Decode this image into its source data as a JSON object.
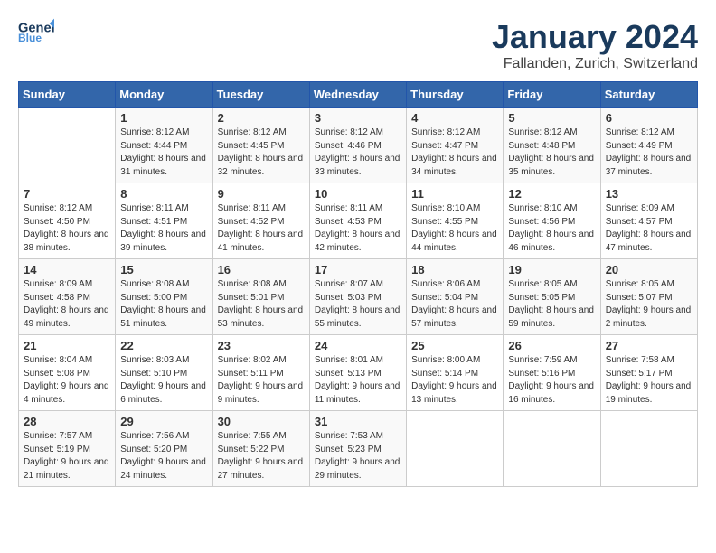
{
  "logo": {
    "general": "General",
    "blue": "Blue"
  },
  "header": {
    "title": "January 2024",
    "subtitle": "Fallanden, Zurich, Switzerland"
  },
  "weekdays": [
    "Sunday",
    "Monday",
    "Tuesday",
    "Wednesday",
    "Thursday",
    "Friday",
    "Saturday"
  ],
  "weeks": [
    [
      {
        "day": "",
        "sunrise": "",
        "sunset": "",
        "daylight": ""
      },
      {
        "day": "1",
        "sunrise": "Sunrise: 8:12 AM",
        "sunset": "Sunset: 4:44 PM",
        "daylight": "Daylight: 8 hours and 31 minutes."
      },
      {
        "day": "2",
        "sunrise": "Sunrise: 8:12 AM",
        "sunset": "Sunset: 4:45 PM",
        "daylight": "Daylight: 8 hours and 32 minutes."
      },
      {
        "day": "3",
        "sunrise": "Sunrise: 8:12 AM",
        "sunset": "Sunset: 4:46 PM",
        "daylight": "Daylight: 8 hours and 33 minutes."
      },
      {
        "day": "4",
        "sunrise": "Sunrise: 8:12 AM",
        "sunset": "Sunset: 4:47 PM",
        "daylight": "Daylight: 8 hours and 34 minutes."
      },
      {
        "day": "5",
        "sunrise": "Sunrise: 8:12 AM",
        "sunset": "Sunset: 4:48 PM",
        "daylight": "Daylight: 8 hours and 35 minutes."
      },
      {
        "day": "6",
        "sunrise": "Sunrise: 8:12 AM",
        "sunset": "Sunset: 4:49 PM",
        "daylight": "Daylight: 8 hours and 37 minutes."
      }
    ],
    [
      {
        "day": "7",
        "sunrise": "Sunrise: 8:12 AM",
        "sunset": "Sunset: 4:50 PM",
        "daylight": "Daylight: 8 hours and 38 minutes."
      },
      {
        "day": "8",
        "sunrise": "Sunrise: 8:11 AM",
        "sunset": "Sunset: 4:51 PM",
        "daylight": "Daylight: 8 hours and 39 minutes."
      },
      {
        "day": "9",
        "sunrise": "Sunrise: 8:11 AM",
        "sunset": "Sunset: 4:52 PM",
        "daylight": "Daylight: 8 hours and 41 minutes."
      },
      {
        "day": "10",
        "sunrise": "Sunrise: 8:11 AM",
        "sunset": "Sunset: 4:53 PM",
        "daylight": "Daylight: 8 hours and 42 minutes."
      },
      {
        "day": "11",
        "sunrise": "Sunrise: 8:10 AM",
        "sunset": "Sunset: 4:55 PM",
        "daylight": "Daylight: 8 hours and 44 minutes."
      },
      {
        "day": "12",
        "sunrise": "Sunrise: 8:10 AM",
        "sunset": "Sunset: 4:56 PM",
        "daylight": "Daylight: 8 hours and 46 minutes."
      },
      {
        "day": "13",
        "sunrise": "Sunrise: 8:09 AM",
        "sunset": "Sunset: 4:57 PM",
        "daylight": "Daylight: 8 hours and 47 minutes."
      }
    ],
    [
      {
        "day": "14",
        "sunrise": "Sunrise: 8:09 AM",
        "sunset": "Sunset: 4:58 PM",
        "daylight": "Daylight: 8 hours and 49 minutes."
      },
      {
        "day": "15",
        "sunrise": "Sunrise: 8:08 AM",
        "sunset": "Sunset: 5:00 PM",
        "daylight": "Daylight: 8 hours and 51 minutes."
      },
      {
        "day": "16",
        "sunrise": "Sunrise: 8:08 AM",
        "sunset": "Sunset: 5:01 PM",
        "daylight": "Daylight: 8 hours and 53 minutes."
      },
      {
        "day": "17",
        "sunrise": "Sunrise: 8:07 AM",
        "sunset": "Sunset: 5:03 PM",
        "daylight": "Daylight: 8 hours and 55 minutes."
      },
      {
        "day": "18",
        "sunrise": "Sunrise: 8:06 AM",
        "sunset": "Sunset: 5:04 PM",
        "daylight": "Daylight: 8 hours and 57 minutes."
      },
      {
        "day": "19",
        "sunrise": "Sunrise: 8:05 AM",
        "sunset": "Sunset: 5:05 PM",
        "daylight": "Daylight: 8 hours and 59 minutes."
      },
      {
        "day": "20",
        "sunrise": "Sunrise: 8:05 AM",
        "sunset": "Sunset: 5:07 PM",
        "daylight": "Daylight: 9 hours and 2 minutes."
      }
    ],
    [
      {
        "day": "21",
        "sunrise": "Sunrise: 8:04 AM",
        "sunset": "Sunset: 5:08 PM",
        "daylight": "Daylight: 9 hours and 4 minutes."
      },
      {
        "day": "22",
        "sunrise": "Sunrise: 8:03 AM",
        "sunset": "Sunset: 5:10 PM",
        "daylight": "Daylight: 9 hours and 6 minutes."
      },
      {
        "day": "23",
        "sunrise": "Sunrise: 8:02 AM",
        "sunset": "Sunset: 5:11 PM",
        "daylight": "Daylight: 9 hours and 9 minutes."
      },
      {
        "day": "24",
        "sunrise": "Sunrise: 8:01 AM",
        "sunset": "Sunset: 5:13 PM",
        "daylight": "Daylight: 9 hours and 11 minutes."
      },
      {
        "day": "25",
        "sunrise": "Sunrise: 8:00 AM",
        "sunset": "Sunset: 5:14 PM",
        "daylight": "Daylight: 9 hours and 13 minutes."
      },
      {
        "day": "26",
        "sunrise": "Sunrise: 7:59 AM",
        "sunset": "Sunset: 5:16 PM",
        "daylight": "Daylight: 9 hours and 16 minutes."
      },
      {
        "day": "27",
        "sunrise": "Sunrise: 7:58 AM",
        "sunset": "Sunset: 5:17 PM",
        "daylight": "Daylight: 9 hours and 19 minutes."
      }
    ],
    [
      {
        "day": "28",
        "sunrise": "Sunrise: 7:57 AM",
        "sunset": "Sunset: 5:19 PM",
        "daylight": "Daylight: 9 hours and 21 minutes."
      },
      {
        "day": "29",
        "sunrise": "Sunrise: 7:56 AM",
        "sunset": "Sunset: 5:20 PM",
        "daylight": "Daylight: 9 hours and 24 minutes."
      },
      {
        "day": "30",
        "sunrise": "Sunrise: 7:55 AM",
        "sunset": "Sunset: 5:22 PM",
        "daylight": "Daylight: 9 hours and 27 minutes."
      },
      {
        "day": "31",
        "sunrise": "Sunrise: 7:53 AM",
        "sunset": "Sunset: 5:23 PM",
        "daylight": "Daylight: 9 hours and 29 minutes."
      },
      {
        "day": "",
        "sunrise": "",
        "sunset": "",
        "daylight": ""
      },
      {
        "day": "",
        "sunrise": "",
        "sunset": "",
        "daylight": ""
      },
      {
        "day": "",
        "sunrise": "",
        "sunset": "",
        "daylight": ""
      }
    ]
  ]
}
